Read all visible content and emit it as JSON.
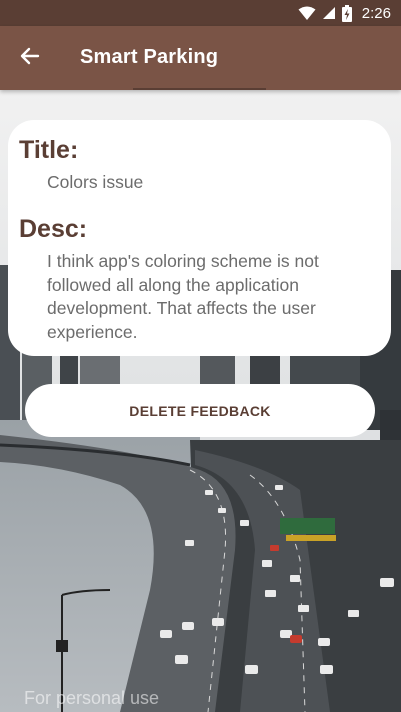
{
  "status_bar": {
    "time": "2:26",
    "icons": [
      "wifi-icon",
      "cell-signal-icon",
      "battery-charging-icon"
    ]
  },
  "app_bar": {
    "title": "Smart Parking",
    "back_icon": "arrow-back-icon"
  },
  "feedback": {
    "title_label": "Title:",
    "title_value": "Colors issue",
    "desc_label": "Desc:",
    "desc_value": "I think app's coloring scheme is not followed all along the application development. That affects the user experience."
  },
  "actions": {
    "delete_label": "DELETE FEEDBACK"
  },
  "background": {
    "watermark": "For personal use"
  },
  "colors": {
    "status_bar": "#5a3e34",
    "app_bar": "#7a5446",
    "accent_text": "#5a3e34",
    "body_text": "#6c6c6c",
    "card": "#ffffff"
  }
}
